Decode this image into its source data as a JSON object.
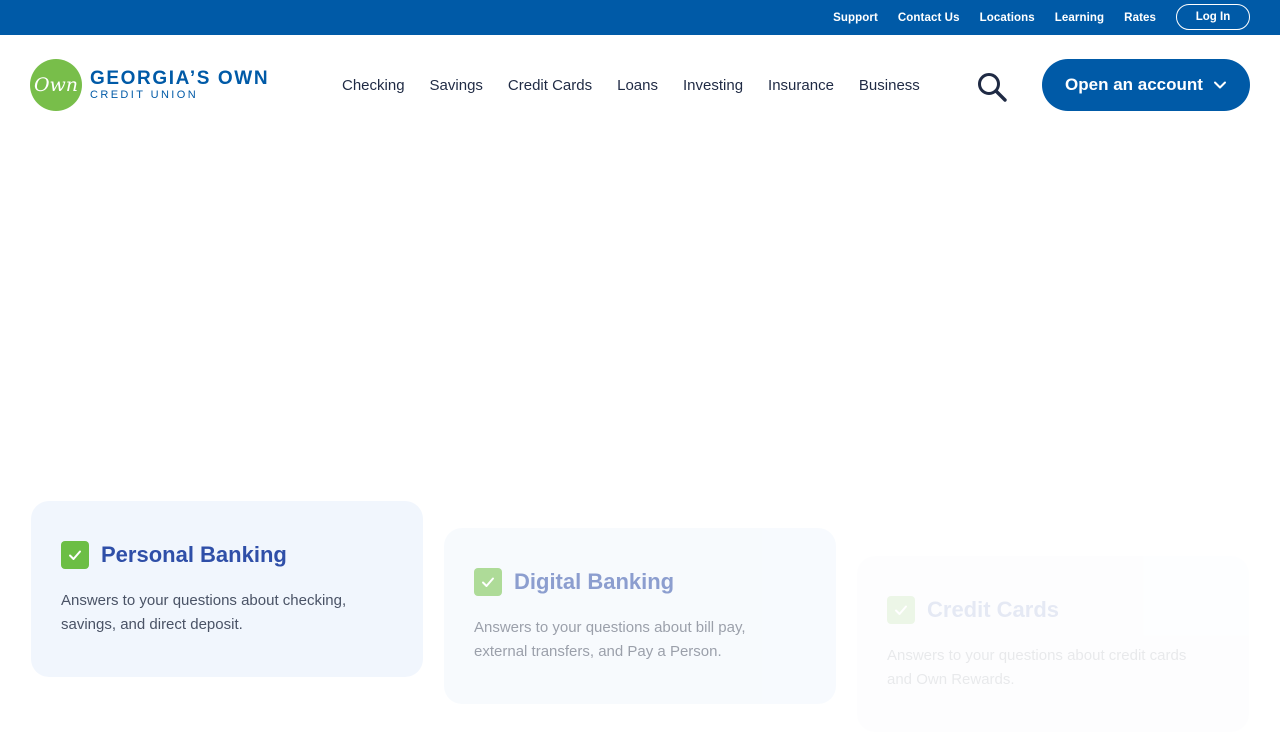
{
  "utility_bar": {
    "links": [
      "Support",
      "Contact Us",
      "Locations",
      "Learning",
      "Rates"
    ],
    "login_label": "Log In"
  },
  "logo": {
    "mark_text": "Own",
    "line1": "GEORGIA’S OWN",
    "line2": "CREDIT UNION"
  },
  "nav": {
    "items": [
      "Checking",
      "Savings",
      "Credit Cards",
      "Loans",
      "Investing",
      "Insurance",
      "Business"
    ]
  },
  "cta": {
    "open_account_label": "Open an account"
  },
  "cards": [
    {
      "title": "Personal Banking",
      "description": "Answers to your questions about checking, savings, and direct deposit."
    },
    {
      "title": "Digital Banking",
      "description": "Answers to your questions about bill pay, external transfers, and Pay a Person."
    },
    {
      "title": "Credit Cards",
      "description": "Answers to your questions about credit cards and Own Rewards."
    }
  ],
  "colors": {
    "brand_blue": "#005aa7",
    "brand_green": "#78be4a",
    "check_green": "#6cbe45",
    "card_bg": "#f1f6fd",
    "card_title": "#2f4fa8"
  },
  "icons": {
    "search": "search-icon",
    "chevron": "chevron-down-icon",
    "check": "checkmark-icon"
  }
}
